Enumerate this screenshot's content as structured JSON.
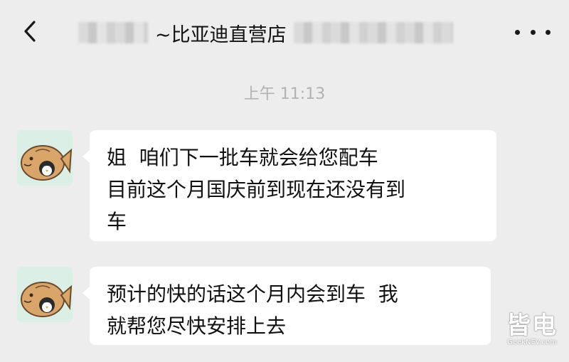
{
  "header": {
    "title": "~比亚迪直营店",
    "back_icon": "chevron-left-icon",
    "more_icon": "more-dots-icon"
  },
  "timestamp": "上午 11:13",
  "messages": [
    {
      "sender": "store",
      "avatar_icon": "fish-penguin-avatar",
      "lines": [
        "姐  咱们下一批车就会给您配车",
        "目前这个月国庆前到现在还没有到",
        "车"
      ]
    },
    {
      "sender": "store",
      "avatar_icon": "fish-penguin-avatar",
      "lines": [
        "预计的快的话这个月内会到车  我",
        "就帮您尽快安排上去"
      ]
    }
  ],
  "watermark": {
    "main": "皆电",
    "sub": "GeekNEV.com"
  },
  "colors": {
    "background": "#ededed",
    "bubble": "#ffffff",
    "avatar_bg": "#dcefe6",
    "timestamp": "#b2b2b2"
  }
}
